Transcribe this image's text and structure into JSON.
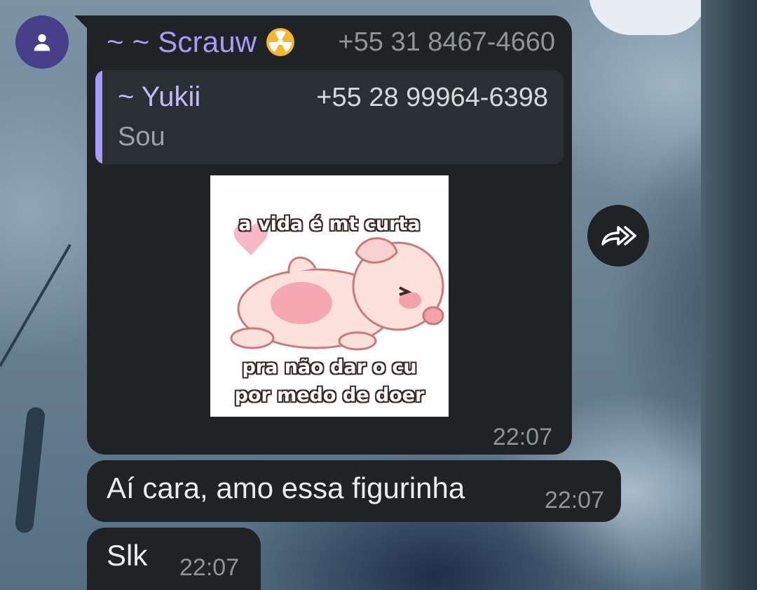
{
  "wallpaper": {
    "description_icon": "anime-wallpaper"
  },
  "colors": {
    "bubble_bg": "#1f2326",
    "quote_bg": "#2a2f33",
    "accent_purple": "#a99af5",
    "avatar_bg": "#473f8a",
    "time_text": "#8d9599",
    "message_text": "#e9edef"
  },
  "message1": {
    "sender_name": "~ ~ Scrauw",
    "sender_emoji": "radioactive-icon",
    "sender_phone": "+55 31 8467-4660",
    "quoted": {
      "name": "~ Yukii",
      "phone": "+55 28 99964-6398",
      "text": "Sou"
    },
    "sticker": {
      "caption_top": "a vida é mt curta",
      "caption_bottom_1": "pra não dar o cu",
      "caption_bottom_2": "por medo de doer"
    },
    "time": "22:07"
  },
  "message2": {
    "text": "Aí cara, amo essa figurinha",
    "time": "22:07"
  },
  "message3": {
    "text": "Slk",
    "time": "22:07"
  }
}
